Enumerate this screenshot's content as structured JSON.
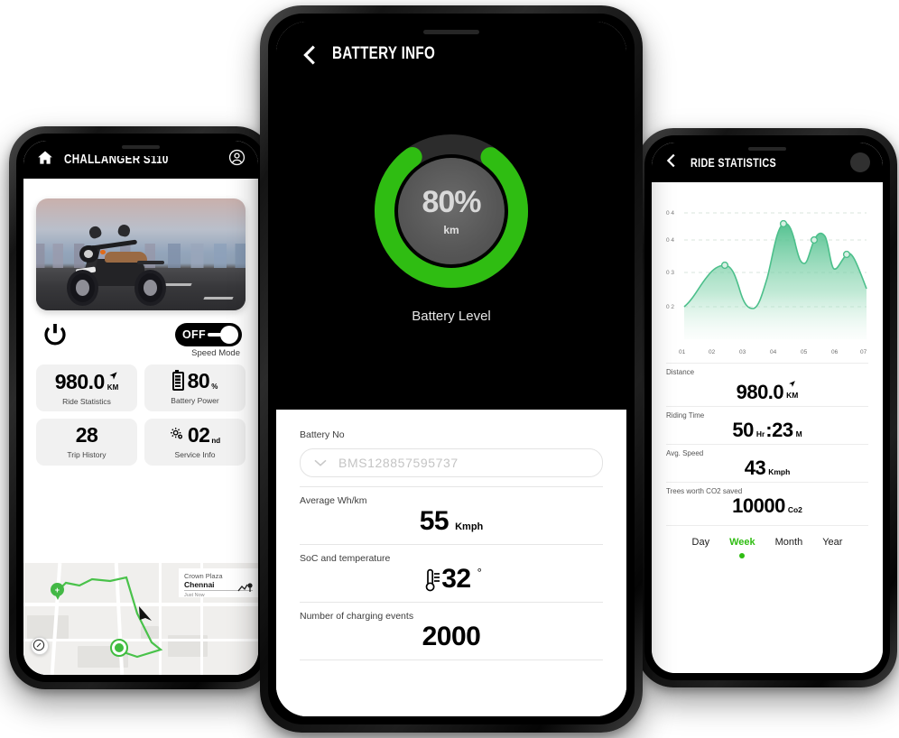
{
  "accent_green": "#2FBD12",
  "left_phone": {
    "header": {
      "title": "CHALLANGER S110",
      "home_icon": "home-icon",
      "profile_icon": "account-circle-icon"
    },
    "power_icon": "power-icon",
    "speed_toggle": {
      "state_label": "OFF",
      "caption": "Speed Mode"
    },
    "stats": [
      {
        "value": "980.0",
        "unit": "KM",
        "caption": "Ride Statistics",
        "icon": "navigation-arrow-icon"
      },
      {
        "value": "80",
        "unit": "%",
        "caption": "Battery Power",
        "icon": "battery-icon"
      },
      {
        "value": "28",
        "unit": "",
        "caption": "Trip History",
        "icon": ""
      },
      {
        "value": "02",
        "unit": "nd",
        "caption": "Service Info",
        "icon": "gear-icon"
      }
    ],
    "map": {
      "place_title": "Crown Plaza",
      "place_city": "Chennai",
      "place_time": "Just Now",
      "compass_icon": "compass-icon",
      "start_icon": "hospital-pin-icon",
      "end_icon": "location-dot-icon"
    }
  },
  "center_phone": {
    "header": {
      "back_icon": "chevron-left-icon",
      "title": "BATTERY INFO"
    },
    "gauge": {
      "percent": "80%",
      "sub_unit": "km",
      "value": 80,
      "caption": "Battery Level"
    },
    "fields": [
      {
        "label": "Battery No",
        "type": "select",
        "value": "BMS128857595737",
        "chevron": "chevron-down-icon"
      },
      {
        "label": "Average Wh/km",
        "type": "value",
        "value": "55",
        "unit": "Kmph"
      },
      {
        "label": "SoC and temperature",
        "type": "value",
        "value": "32",
        "unit": "°",
        "icon": "thermometer-icon"
      },
      {
        "label": "Number of charging events",
        "type": "value",
        "value": "2000",
        "unit": ""
      }
    ]
  },
  "right_phone": {
    "header": {
      "back_icon": "chevron-left-icon",
      "title": "RIDE STATISTICS",
      "avatar": "avatar"
    },
    "stats": [
      {
        "label": "Distance",
        "value": "980.0",
        "unit": "KM",
        "icon": "navigation-arrow-icon"
      },
      {
        "label": "Riding Time",
        "value": "50",
        "unit": "Hr",
        "value2": "23",
        "unit2": "M",
        "separator": ":"
      },
      {
        "label": "Avg. Speed",
        "value": "43",
        "unit": "Kmph"
      },
      {
        "label": "Trees worth CO2 saved",
        "value": "10000",
        "unit": "Co2"
      }
    ],
    "range_tabs": [
      {
        "label": "Day",
        "active": false
      },
      {
        "label": "Week",
        "active": true
      },
      {
        "label": "Month",
        "active": false
      },
      {
        "label": "Year",
        "active": false
      }
    ],
    "chart_data": {
      "type": "area",
      "title": "",
      "xlabel": "",
      "ylabel": "",
      "x": [
        "01",
        "02",
        "03",
        "04",
        "05",
        "06",
        "07"
      ],
      "xtick_labels": [
        "01",
        "02",
        "03",
        "04",
        "05",
        "06",
        "07"
      ],
      "ytick_labels": [
        "0 4",
        "0 4",
        "0 3",
        "0 2"
      ],
      "ytick_values": [
        0.5,
        0.4,
        0.3,
        0.2
      ],
      "ylim": [
        0.1,
        0.55
      ],
      "grid": true,
      "legend": "none",
      "series": [
        {
          "name": "distance",
          "color": "#4CBF8B",
          "values": [
            0.215,
            0.335,
            0.215,
            0.48,
            0.445,
            0.37,
            0.275
          ]
        }
      ],
      "markers": [
        {
          "x": "02",
          "y": 0.335
        },
        {
          "x": "04",
          "y": 0.48
        },
        {
          "x": "05",
          "y": 0.445
        },
        {
          "x": "06",
          "y": 0.37
        }
      ]
    }
  }
}
